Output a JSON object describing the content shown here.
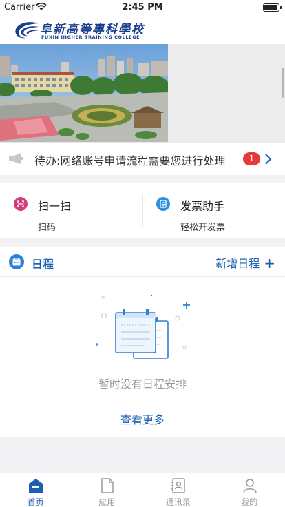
{
  "status_bar": {
    "carrier": "Carrier",
    "time": "2:45 PM"
  },
  "header": {
    "logo_cn": "阜新高等專科學校",
    "logo_en": "FUXIN HIGHER TRAINING COLLEGE"
  },
  "notice": {
    "text": "待办:网络账号申请流程需要您进行处理",
    "badge": "1"
  },
  "quick_actions": [
    {
      "title": "扫一扫",
      "subtitle": "扫码",
      "icon": "scan-icon",
      "color": "#d63a7f"
    },
    {
      "title": "发票助手",
      "subtitle": "轻松开发票",
      "icon": "invoice-icon",
      "color": "#2d8fe0"
    }
  ],
  "schedule": {
    "title": "日程",
    "add_label": "新增日程",
    "add_icon": "+",
    "empty_text": "暂时没有日程安排",
    "view_more": "查看更多"
  },
  "tabs": [
    {
      "label": "首页",
      "icon": "home-icon",
      "active": true
    },
    {
      "label": "应用",
      "icon": "app-icon",
      "active": false
    },
    {
      "label": "通讯录",
      "icon": "contacts-icon",
      "active": false
    },
    {
      "label": "我的",
      "icon": "profile-icon",
      "active": false
    }
  ],
  "colors": {
    "accent": "#1d5fb2",
    "badge": "#e5393a",
    "inactive": "#9a9a9a"
  }
}
